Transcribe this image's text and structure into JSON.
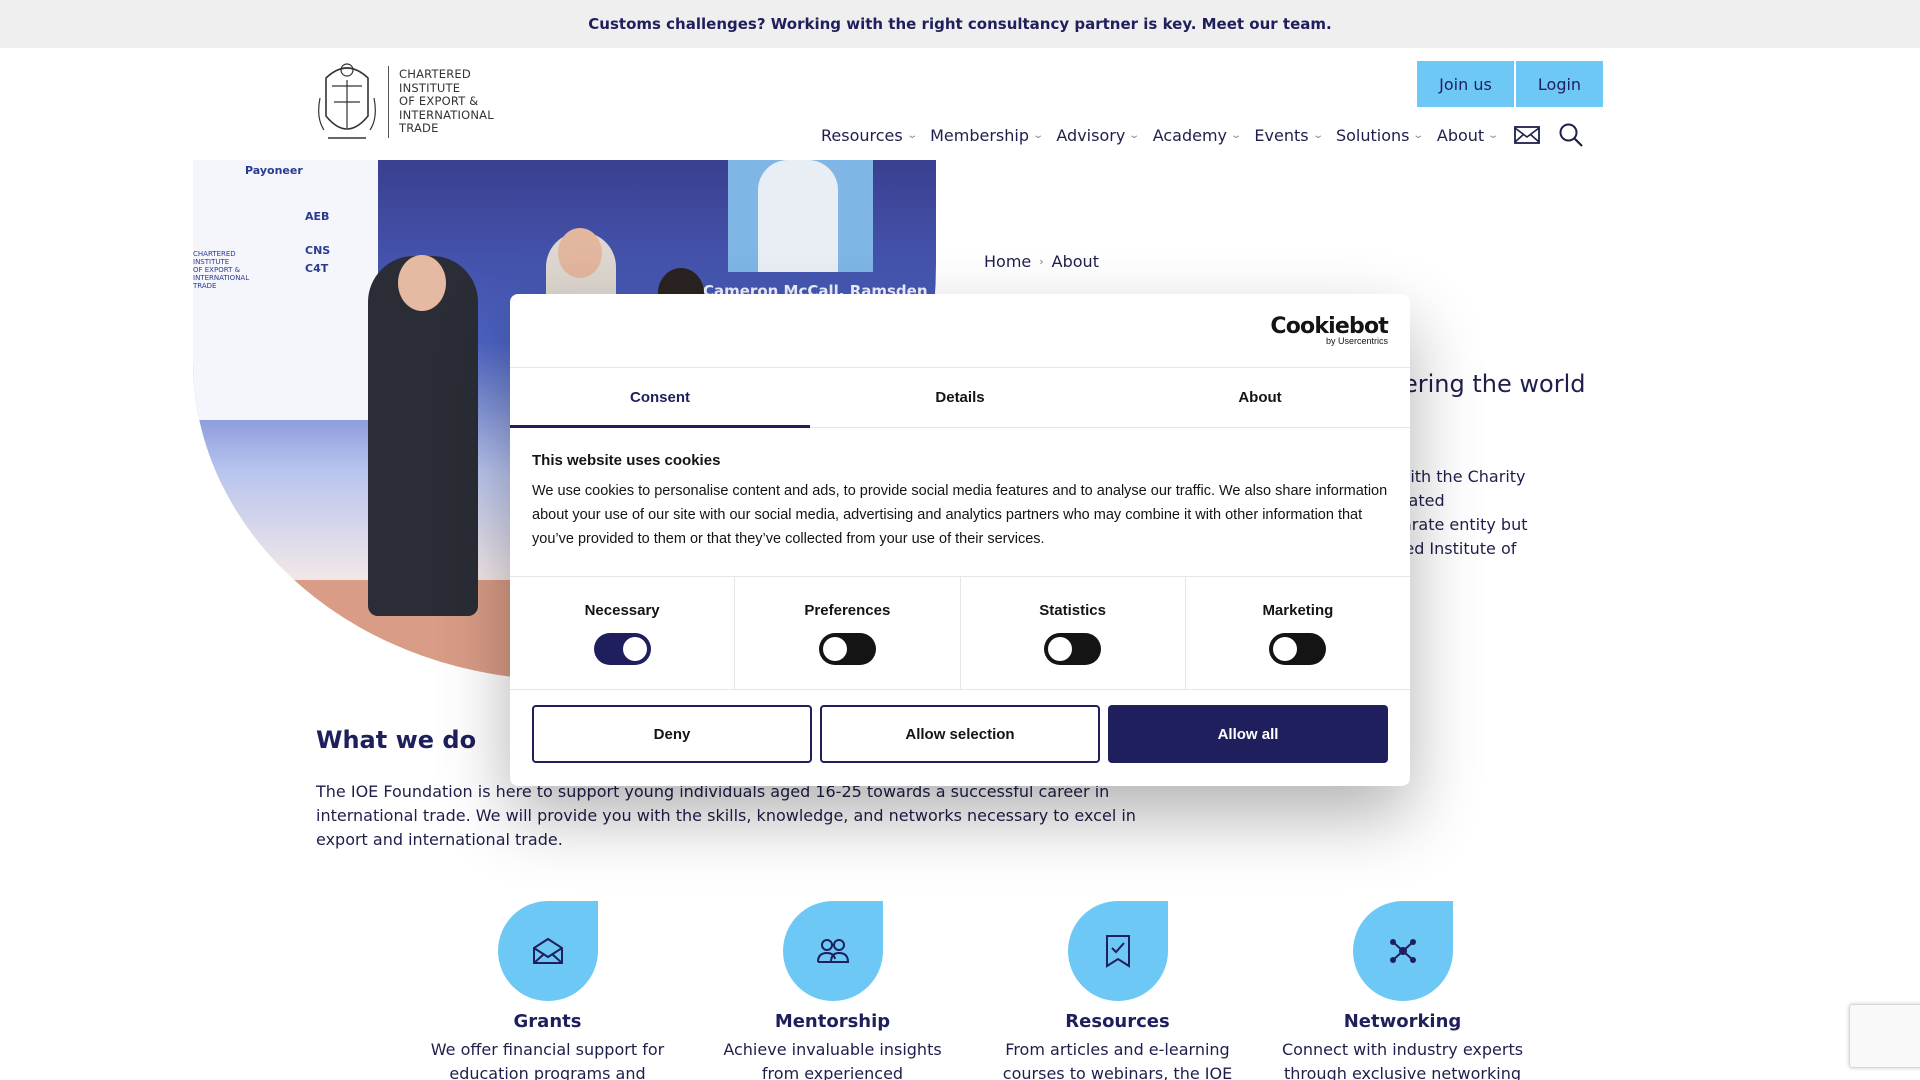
{
  "announcement": {
    "text": "Customs challenges? Working with the right consultancy partner is key. Meet our team."
  },
  "header": {
    "logo_lines": [
      "CHARTERED",
      "INSTITUTE",
      "OF EXPORT &",
      "INTERNATIONAL",
      "TRADE"
    ],
    "join_label": "Join us",
    "login_label": "Login",
    "nav": [
      {
        "label": "Resources"
      },
      {
        "label": "Membership"
      },
      {
        "label": "Advisory"
      },
      {
        "label": "Academy"
      },
      {
        "label": "Events"
      },
      {
        "label": "Solutions"
      },
      {
        "label": "About"
      }
    ],
    "mail_icon": "mail-icon",
    "search_icon": "search-icon"
  },
  "hero": {
    "sponsor_top": "Payoneer",
    "sponsor_logos": [
      "AEB",
      "CNS",
      "C4T"
    ],
    "panel_lines": [
      "CHARTERED",
      "INSTITUTE",
      "OF EXPORT &",
      "INTERNATIONAL",
      "TRADE"
    ],
    "caption": "Cameron McCall, Ramsden Int"
  },
  "breadcrumb": {
    "home": "Home",
    "current": "About"
  },
  "about": {
    "subtitle_fragment": "ering the world",
    "paragraph_fragments": [
      "d with the Charity",
      "porated",
      "eparate entity but",
      "tered Institute of"
    ]
  },
  "what_we_do": {
    "title": "What we do",
    "text": "The IOE Foundation is here to support young individuals aged 16-25 towards a successful career in international trade. We will provide you with the skills, knowledge, and networks necessary to excel in export and international trade."
  },
  "features": [
    {
      "icon": "envelope-icon",
      "title": "Grants",
      "desc": "We offer financial support for education programs and"
    },
    {
      "icon": "people-icon",
      "title": "Mentorship",
      "desc": "Achieve invaluable insights from experienced"
    },
    {
      "icon": "bookmark-check-icon",
      "title": "Resources",
      "desc": "From articles and e-learning courses to webinars, the IOE"
    },
    {
      "icon": "network-icon",
      "title": "Networking",
      "desc": "Connect with industry experts through exclusive networking"
    }
  ],
  "cookie": {
    "brand": "Cookiebot",
    "brand_sub": "by Usercentrics",
    "tabs": [
      "Consent",
      "Details",
      "About"
    ],
    "active_tab": "Consent",
    "heading": "This website uses cookies",
    "body": "We use cookies to personalise content and ads, to provide social media features and to analyse our traffic. We also share information about your use of our site with our social media, advertising and analytics partners who may combine it with other information that you’ve provided to them or that they’ve collected from your use of their services.",
    "categories": [
      {
        "label": "Necessary",
        "enabled": true
      },
      {
        "label": "Preferences",
        "enabled": false
      },
      {
        "label": "Statistics",
        "enabled": false
      },
      {
        "label": "Marketing",
        "enabled": false
      }
    ],
    "deny_label": "Deny",
    "allow_selection_label": "Allow selection",
    "allow_all_label": "Allow all"
  },
  "colors": {
    "navy": "#1e1f5c",
    "accent": "#6ec8f5",
    "topbar_bg": "#efefef"
  }
}
